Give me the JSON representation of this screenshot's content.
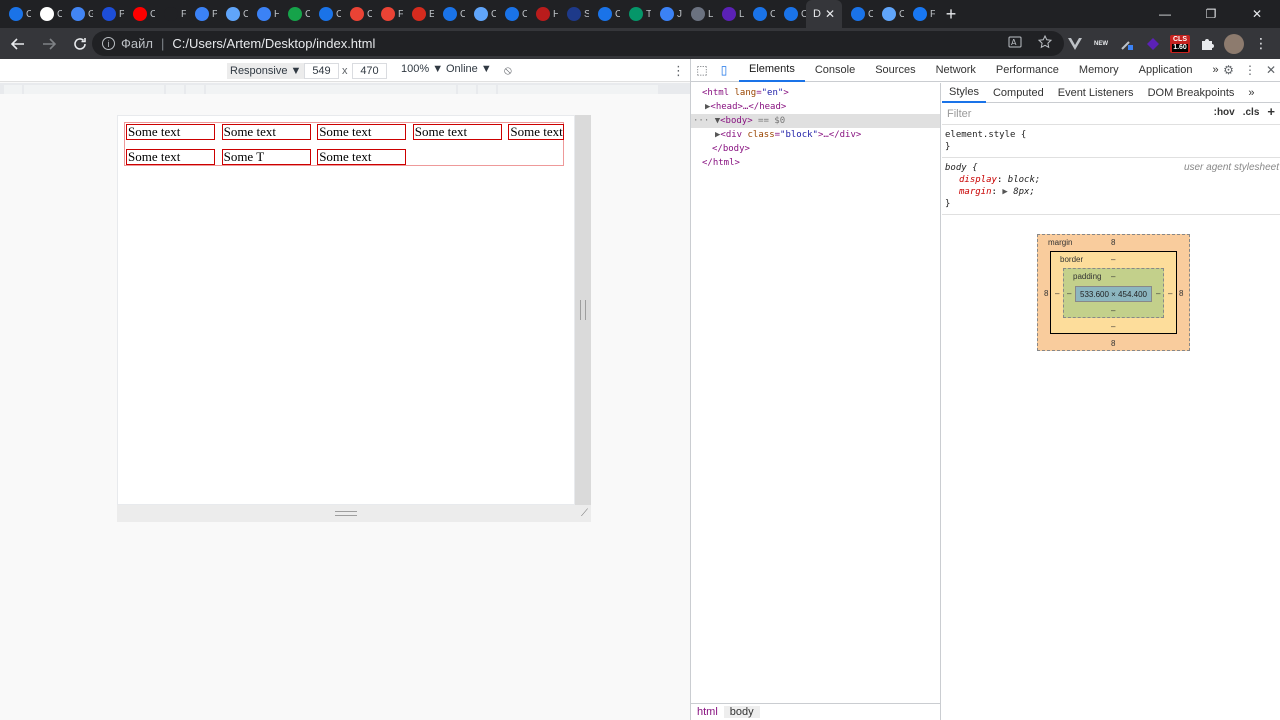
{
  "tabs": [
    {
      "icon": "chrome-icon",
      "color": "#1a73e8",
      "title": "C"
    },
    {
      "icon": "circle-icon",
      "color": "#ffffff",
      "title": "C"
    },
    {
      "icon": "google-icon",
      "color": "#4285f4",
      "title": "G"
    },
    {
      "icon": "bird-icon",
      "color": "#1d4ed8",
      "title": "P"
    },
    {
      "icon": "youtube-icon",
      "color": "#ff0000",
      "title": "C"
    },
    {
      "icon": "blank-icon",
      "color": "#202124",
      "title": "F"
    },
    {
      "icon": "web-icon",
      "color": "#3b82f6",
      "title": "P"
    },
    {
      "icon": "chat-icon",
      "color": "#60a5fa",
      "title": "C"
    },
    {
      "icon": "web-icon",
      "color": "#3b82f6",
      "title": "H"
    },
    {
      "icon": "excel-icon",
      "color": "#16a34a",
      "title": "C"
    },
    {
      "icon": "chrome-icon",
      "color": "#1a73e8",
      "title": "C"
    },
    {
      "icon": "gmail-icon",
      "color": "#ea4335",
      "title": "C"
    },
    {
      "icon": "gmail-icon",
      "color": "#ea4335",
      "title": "F"
    },
    {
      "icon": "flag-icon",
      "color": "#d52b1e",
      "title": "E"
    },
    {
      "icon": "chrome-icon",
      "color": "#1a73e8",
      "title": "C"
    },
    {
      "icon": "chat-icon",
      "color": "#60a5fa",
      "title": "C"
    },
    {
      "icon": "chrome-icon",
      "color": "#1a73e8",
      "title": "C"
    },
    {
      "icon": "lambda-icon",
      "color": "#b91c1c",
      "title": "H"
    },
    {
      "icon": "arrow-icon",
      "color": "#1e3a8a",
      "title": "S"
    },
    {
      "icon": "chrome-icon",
      "color": "#1a73e8",
      "title": "C"
    },
    {
      "icon": "triangle-icon",
      "color": "#059669",
      "title": "T"
    },
    {
      "icon": "shield-icon",
      "color": "#3b82f6",
      "title": "J"
    },
    {
      "icon": "peak-icon",
      "color": "#6b7280",
      "title": "L"
    },
    {
      "icon": "hex-icon",
      "color": "#5b21b6",
      "title": "L"
    },
    {
      "icon": "chrome-icon",
      "color": "#1a73e8",
      "title": "C"
    },
    {
      "icon": "chrome-icon",
      "color": "#1a73e8",
      "title": "C"
    }
  ],
  "active_tab": {
    "title": "D",
    "close": "✕"
  },
  "tabs_after": [
    {
      "icon": "chrome-icon",
      "color": "#1a73e8",
      "title": "C"
    },
    {
      "icon": "chat-icon",
      "color": "#60a5fa",
      "title": "C"
    },
    {
      "icon": "facebook-icon",
      "color": "#1877f2",
      "title": "F"
    }
  ],
  "new_tab_label": "+",
  "window_controls": {
    "minimize": "—",
    "maximize": "❐",
    "close": "✕"
  },
  "address_bar": {
    "info_label": "i",
    "scheme_label": "Файл",
    "separator": "|",
    "url": "C:/Users/Artem/Desktop/index.html"
  },
  "cls_badge": {
    "line1": "CLS",
    "line2": "1.60"
  },
  "new_badge": "NEW",
  "device_toolbar": {
    "mode": "Responsive ▼",
    "width": "549",
    "times": "x",
    "height": "470",
    "zoom": "100% ▼",
    "throttle": "Online ▼"
  },
  "page_cells": [
    {
      "text": "Some text"
    },
    {
      "text": "Some text"
    },
    {
      "text": "Some text"
    },
    {
      "text": "Some text"
    },
    {
      "text": "Some text"
    },
    {
      "text": "Some text"
    },
    {
      "text": "Some T"
    },
    {
      "text": "Some text"
    }
  ],
  "devtools": {
    "tabs": [
      "Elements",
      "Console",
      "Sources",
      "Network",
      "Performance",
      "Memory",
      "Application"
    ],
    "active": "Elements",
    "more": "»"
  },
  "dom": {
    "html_open": "<html ",
    "html_attr": "lang",
    "html_val": "\"en\"",
    "head": "<head>…</head>",
    "body_open": "<body>",
    "body_eq": " == $0",
    "div_open": "<div ",
    "div_attr": "class",
    "div_val": "\"block\"",
    "div_rest": ">…</div>",
    "body_close": "</body>",
    "html_close": "</html>",
    "crumbs": [
      "html",
      "body"
    ]
  },
  "styles": {
    "tabs": [
      "Styles",
      "Computed",
      "Event Listeners",
      "DOM Breakpoints"
    ],
    "more": "»",
    "filter_placeholder": "Filter",
    "hov": ":hov",
    "cls": ".cls",
    "plus": "+",
    "element_style": "element.style {",
    "close_brace": "}",
    "body_selector": "body {",
    "ua_label": "user agent stylesheet",
    "prop1": "display",
    "val1": "block;",
    "prop2": "margin",
    "val2": "8px;"
  },
  "box_model": {
    "margin_label": "margin",
    "margin_top": "8",
    "margin_bottom": "8",
    "margin_left": "8",
    "margin_right": "8",
    "border_label": "border",
    "border_top": "–",
    "border_bottom": "–",
    "border_left": "–",
    "border_right": "–",
    "padding_label": "padding",
    "padding_top": "–",
    "padding_bottom": "–",
    "padding_left": "–",
    "padding_right": "–",
    "content_size": "533.600 × 454.400"
  }
}
